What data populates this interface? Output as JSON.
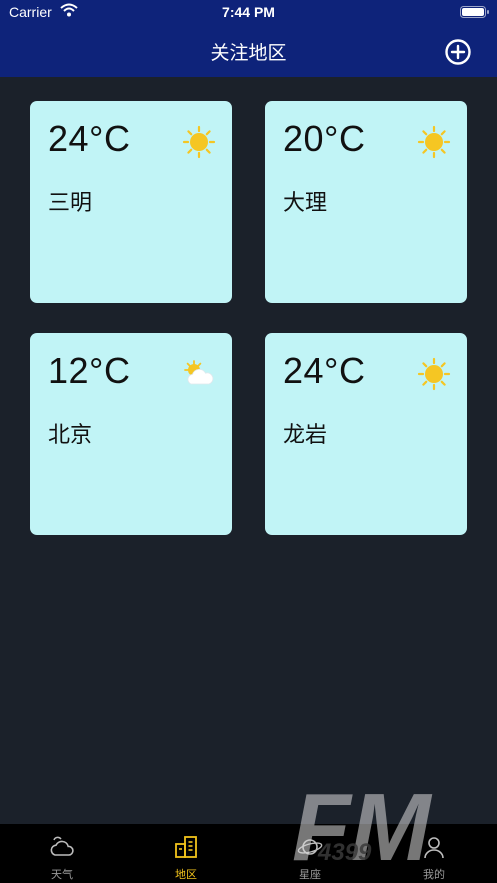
{
  "status_bar": {
    "carrier": "Carrier",
    "time": "7:44 PM"
  },
  "header": {
    "title": "关注地区",
    "add_icon": "plus-circle-icon"
  },
  "cards": [
    {
      "temp": "24°C",
      "city": "三明",
      "icon": "sun-icon"
    },
    {
      "temp": "20°C",
      "city": "大理",
      "icon": "sun-icon"
    },
    {
      "temp": "12°C",
      "city": "北京",
      "icon": "partly-cloudy-icon"
    },
    {
      "temp": "24°C",
      "city": "龙岩",
      "icon": "sun-icon"
    }
  ],
  "tabs": [
    {
      "label": "天气",
      "icon": "cloud-sun-icon",
      "active": false
    },
    {
      "label": "地区",
      "icon": "building-icon",
      "active": true
    },
    {
      "label": "星座",
      "icon": "planet-icon",
      "active": false
    },
    {
      "label": "我的",
      "icon": "user-icon",
      "active": false
    }
  ],
  "watermark": {
    "text": "FM",
    "subtext": "4399"
  },
  "colors": {
    "header_bg": "#0e237a",
    "page_bg": "#1b212a",
    "card_bg": "#c1f4f6",
    "tab_active": "#f2c31b",
    "tab_inactive": "#9a9a9a",
    "sun": "#f5c623"
  }
}
